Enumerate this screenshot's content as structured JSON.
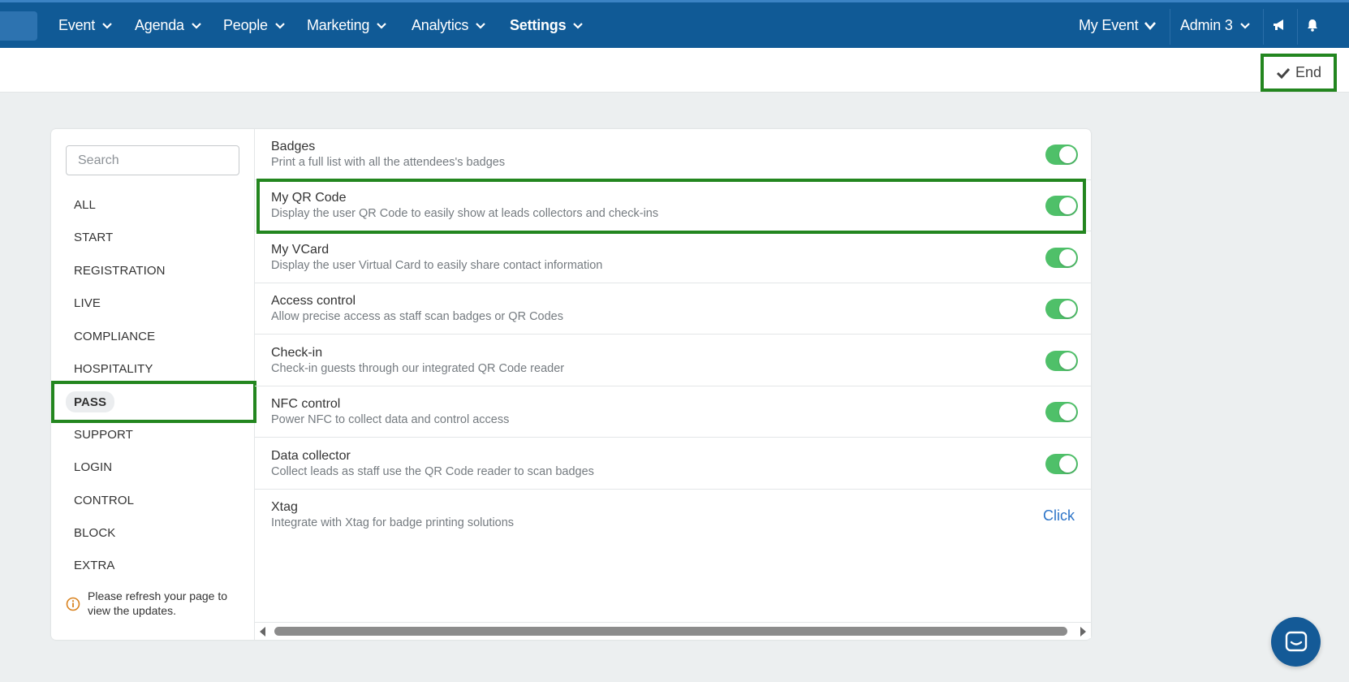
{
  "topnav": {
    "items": [
      {
        "label": "Event"
      },
      {
        "label": "Agenda"
      },
      {
        "label": "People"
      },
      {
        "label": "Marketing"
      },
      {
        "label": "Analytics"
      },
      {
        "label": "Settings"
      }
    ],
    "right": {
      "event_label": "My Event",
      "user_label": "Admin 3"
    }
  },
  "subbar": {
    "end_label": "End"
  },
  "sidebar": {
    "search_placeholder": "Search",
    "categories": [
      {
        "label": "ALL"
      },
      {
        "label": "START"
      },
      {
        "label": "REGISTRATION"
      },
      {
        "label": "LIVE"
      },
      {
        "label": "COMPLIANCE"
      },
      {
        "label": "HOSPITALITY"
      },
      {
        "label": "PASS",
        "active": true
      },
      {
        "label": "SUPPORT"
      },
      {
        "label": "LOGIN"
      },
      {
        "label": "CONTROL"
      },
      {
        "label": "BLOCK"
      },
      {
        "label": "EXTRA"
      }
    ],
    "notice": "Please refresh your page to view the updates."
  },
  "features": [
    {
      "title": "Badges",
      "description": "Print a full list with all the attendees's badges",
      "enabled": true
    },
    {
      "title": "My QR Code",
      "description": "Display the user QR Code to easily show at leads collectors and check-ins",
      "enabled": true
    },
    {
      "title": "My VCard",
      "description": "Display the user Virtual Card to easily share contact information",
      "enabled": true
    },
    {
      "title": "Access control",
      "description": "Allow precise access as staff scan badges or QR Codes",
      "enabled": true
    },
    {
      "title": "Check-in",
      "description": "Check-in guests through our integrated QR Code reader",
      "enabled": true
    },
    {
      "title": "NFC control",
      "description": "Power NFC to collect data and control access",
      "enabled": true
    },
    {
      "title": "Data collector",
      "description": "Collect leads as staff use the QR Code reader to scan badges",
      "enabled": true
    },
    {
      "title": "Xtag",
      "description": "Integrate with Xtag for badge printing solutions",
      "action_label": "Click"
    }
  ],
  "colors": {
    "nav_bg": "#105a96",
    "highlight": "#23861f",
    "toggle_on": "#4fc069",
    "link": "#2d74c8"
  }
}
